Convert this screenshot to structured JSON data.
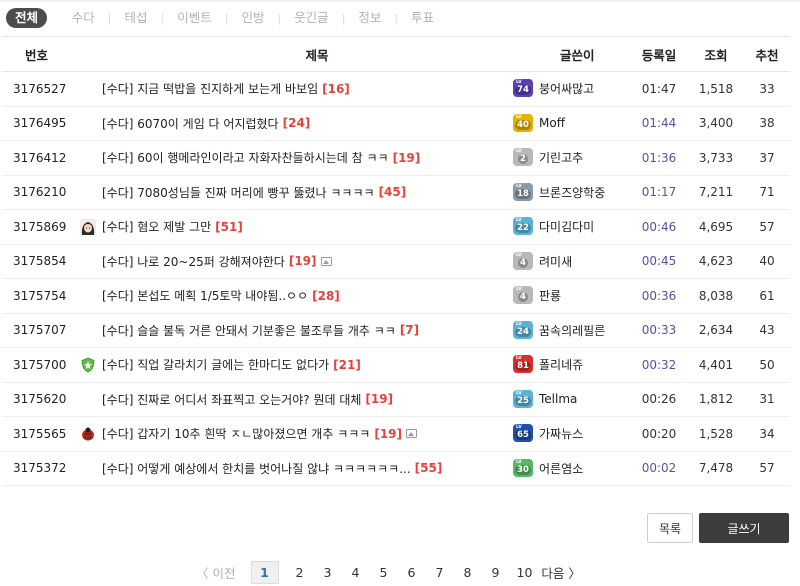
{
  "tabs": [
    "전체",
    "수다",
    "테섭",
    "이벤트",
    "인방",
    "웃긴글",
    "정보",
    "투표"
  ],
  "active_tab": 0,
  "header": {
    "no": "번호",
    "title": "제목",
    "author": "글쓴이",
    "date": "등록일",
    "views": "조회",
    "rec": "추천"
  },
  "colors": {
    "today_date": "#5c4fa0",
    "comment_count": "#e8413b",
    "current_page": "#3a6fb0"
  },
  "rows": [
    {
      "no": "3176527",
      "title": "[수다] 지금 떡밥을 진지하게 보는게 바보임",
      "comments": "[16]",
      "image": false,
      "avatar": "",
      "level": "74",
      "level_color": "#5b3fb5",
      "author": "붕어싸많고",
      "date": "01:47",
      "today": false,
      "views": "1,518",
      "rec": "33"
    },
    {
      "no": "3176495",
      "title": "[수다] 6070이 게임 다 어지럽혔다",
      "comments": "[24]",
      "image": false,
      "avatar": "",
      "level": "40",
      "level_color": "#e2b400",
      "author": "Moff",
      "date": "01:44",
      "today": true,
      "views": "3,400",
      "rec": "38"
    },
    {
      "no": "3176412",
      "title": "[수다] 60이 행메라인이라고 자화자찬들하시는데 참 ㅋㅋ",
      "comments": "[19]",
      "image": false,
      "avatar": "",
      "level": "2",
      "level_color": "#b9b9b9",
      "author": "기린고추",
      "date": "01:36",
      "today": true,
      "views": "3,733",
      "rec": "37"
    },
    {
      "no": "3176210",
      "title": "[수다] 7080성님들 진짜 머리에 빵꾸 뚫렸나 ㅋㅋㅋㅋ",
      "comments": "[45]",
      "image": false,
      "avatar": "",
      "level": "18",
      "level_color": "#8a9aa8",
      "author": "브론즈양학중",
      "date": "01:17",
      "today": true,
      "views": "7,211",
      "rec": "71"
    },
    {
      "no": "3175869",
      "title": "[수다] 혐오 제발 그만",
      "comments": "[51]",
      "image": false,
      "avatar": "girl-avatar",
      "level": "22",
      "level_color": "#5ab3d6",
      "author": "다미김다미",
      "date": "00:46",
      "today": true,
      "views": "4,695",
      "rec": "57"
    },
    {
      "no": "3175854",
      "title": "[수다] 나로 20~25퍼 강해져야한다",
      "comments": "[19]",
      "image": true,
      "avatar": "",
      "level": "4",
      "level_color": "#b9b9b9",
      "author": "려미새",
      "date": "00:45",
      "today": true,
      "views": "4,623",
      "rec": "40"
    },
    {
      "no": "3175754",
      "title": "[수다] 본섭도 메획 1/5토막 내야됨..ㅇㅇ",
      "comments": "[28]",
      "image": false,
      "avatar": "",
      "level": "4",
      "level_color": "#b9b9b9",
      "author": "판룡",
      "date": "00:36",
      "today": true,
      "views": "8,038",
      "rec": "61"
    },
    {
      "no": "3175707",
      "title": "[수다] 슬슬 불독 거른 안돼서 기분좋은 불조루들 개추 ㅋㅋ",
      "comments": "[7]",
      "image": false,
      "avatar": "",
      "level": "24",
      "level_color": "#5ab3d6",
      "author": "꿈속의레필른",
      "date": "00:33",
      "today": true,
      "views": "2,634",
      "rec": "43"
    },
    {
      "no": "3175700",
      "title": "[수다] 직업 갈라치기 글에는 한마디도 없다가",
      "comments": "[21]",
      "image": false,
      "avatar": "shield-avatar",
      "level": "81",
      "level_color": "#d8312c",
      "author": "폴리네쥬",
      "date": "00:32",
      "today": true,
      "views": "4,401",
      "rec": "50"
    },
    {
      "no": "3175620",
      "title": "[수다] 진짜로 어디서 좌표찍고 오는거야? 뭔데 대체",
      "comments": "[19]",
      "image": false,
      "avatar": "",
      "level": "25",
      "level_color": "#5ab3d6",
      "author": "Tellma",
      "date": "00:26",
      "today": false,
      "views": "1,812",
      "rec": "31"
    },
    {
      "no": "3175565",
      "title": "[수다] 갑자기 10추 흰딱 ㅈㄴ많아졌으면 개추 ㅋㅋㅋ",
      "comments": "[19]",
      "image": true,
      "avatar": "ladybug-avatar",
      "level": "65",
      "level_color": "#1f4fa8",
      "author": "가짜뉴스",
      "date": "00:20",
      "today": false,
      "views": "1,528",
      "rec": "34"
    },
    {
      "no": "3175372",
      "title": "[수다] 어떻게 예상에서 한치를 벗어나질 않냐 ㅋㅋㅋㅋㅋㅋ...",
      "comments": "[55]",
      "image": false,
      "avatar": "",
      "level": "30",
      "level_color": "#58b868",
      "author": "어른염소",
      "date": "00:02",
      "today": true,
      "views": "7,478",
      "rec": "57"
    }
  ],
  "buttons": {
    "list": "목록",
    "write": "글쓰기"
  },
  "pager": {
    "prev": "이전",
    "pages": [
      "1",
      "2",
      "3",
      "4",
      "5",
      "6",
      "7",
      "8",
      "9",
      "10"
    ],
    "current": "1",
    "next": "다음"
  }
}
